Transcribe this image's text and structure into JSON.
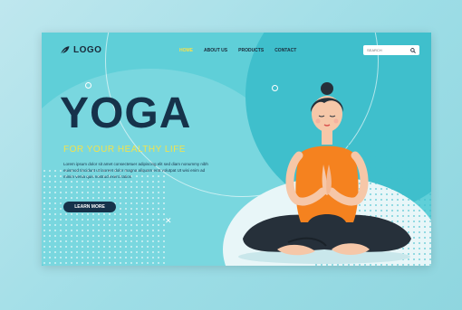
{
  "brand": {
    "logo_text": "LOGO"
  },
  "nav": {
    "items": [
      {
        "label": "HOME",
        "active": true
      },
      {
        "label": "ABOUT US",
        "active": false
      },
      {
        "label": "PRODUCTS",
        "active": false
      },
      {
        "label": "CONTACT",
        "active": false
      }
    ]
  },
  "search": {
    "placeholder": "SEARCH"
  },
  "hero": {
    "title": "YOGA",
    "subtitle": "FOR YOUR HEALTHY LIFE",
    "body": "Lorem ipsum dolor sit amet consectetuer adipiscing elit sed diam nonummy nibh euismod tincidunt ut laoreet dolor magna aliquam erat volutpat Ut wisi enim ad minim venia quis nostrud exerci tation",
    "cta_label": "LEARN MORE"
  },
  "colors": {
    "background": "#5fcfd8",
    "dark": "#16324a",
    "accent": "#f1e24c",
    "shirt": "#f5821f"
  },
  "icons": [
    "leaf-logo-icon",
    "search-icon",
    "cross-icon",
    "circle-icon"
  ]
}
